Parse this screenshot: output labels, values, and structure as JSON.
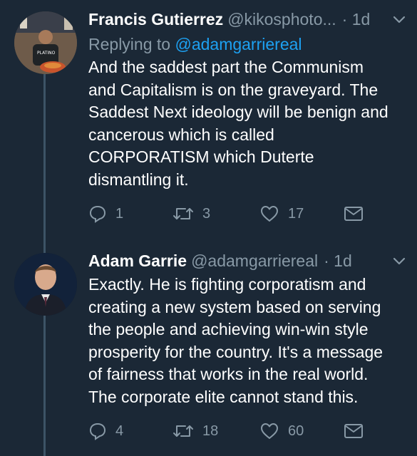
{
  "tweets": [
    {
      "name": "Francis Gutierrez",
      "handle": "@kikosphoto...",
      "time": "· 1d",
      "reply_prefix": "Replying to",
      "reply_mention": "@adamgarriereal",
      "lines": [
        "And the saddest part the Communism",
        "and Capitalism is on the graveyard. The",
        "Saddest Next ideology will be benign and",
        "cancerous which is called",
        "CORPORATISM which Duterte",
        "dismantling it."
      ],
      "replies": "1",
      "retweets": "3",
      "likes": "17"
    },
    {
      "name": "Adam Garrie",
      "handle": "@adamgarriereal",
      "time": "· 1d",
      "lines": [
        "Exactly. He is fighting corporatism and",
        "creating a new system based on serving",
        "the people and achieving win-win style",
        "prosperity for the country. It's a message",
        "of fairness that works in the real world.",
        "The corporate elite cannot stand this."
      ],
      "replies": "4",
      "retweets": "18",
      "likes": "60"
    }
  ],
  "icons": {
    "reply": "reply-icon",
    "retweet": "retweet-icon",
    "like": "heart-icon",
    "message": "envelope-icon",
    "menu": "chevron-down-icon"
  },
  "colors": {
    "background": "#1b2836",
    "secondary_text": "#8899a6",
    "link": "#1da1f2",
    "thread_line": "#3d5466"
  }
}
